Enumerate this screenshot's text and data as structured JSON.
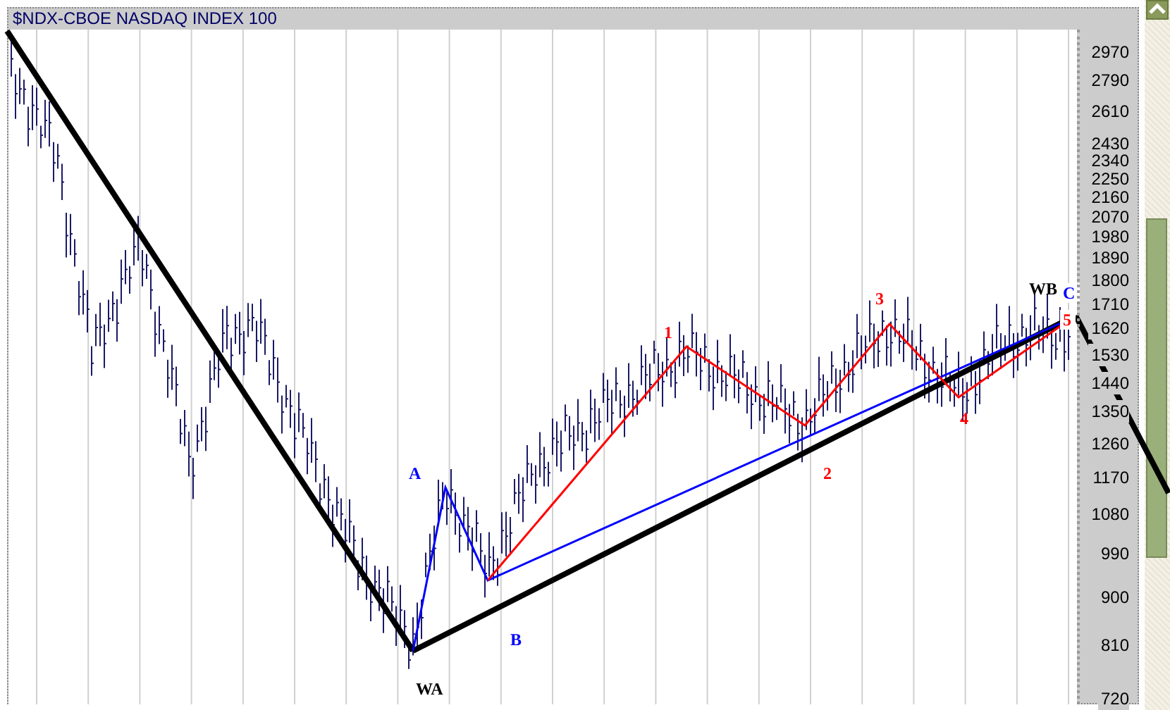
{
  "chart": {
    "title": "$NDX-CBOE NASDAQ INDEX 100",
    "y_axis_ticks": [
      "2970",
      "2790",
      "2610",
      "2430",
      "2340",
      "2250",
      "2160",
      "2070",
      "1980",
      "1890",
      "1800",
      "1710",
      "1620",
      "1530",
      "1440",
      "1350",
      "1260",
      "1170",
      "1080",
      "990",
      "900",
      "810",
      "720"
    ],
    "wave_labels": [
      {
        "text": "A",
        "color": "#0000ff"
      },
      {
        "text": "B",
        "color": "#0000ff"
      },
      {
        "text": "WA",
        "color": "#000000"
      },
      {
        "text": "1",
        "color": "#ff0000"
      },
      {
        "text": "2",
        "color": "#ff0000"
      },
      {
        "text": "3",
        "color": "#ff0000"
      },
      {
        "text": "4",
        "color": "#ff0000"
      },
      {
        "text": "WB",
        "color": "#000000"
      },
      {
        "text": "C",
        "color": "#0000ff"
      },
      {
        "text": "5",
        "color": "#ff0000"
      }
    ]
  }
}
